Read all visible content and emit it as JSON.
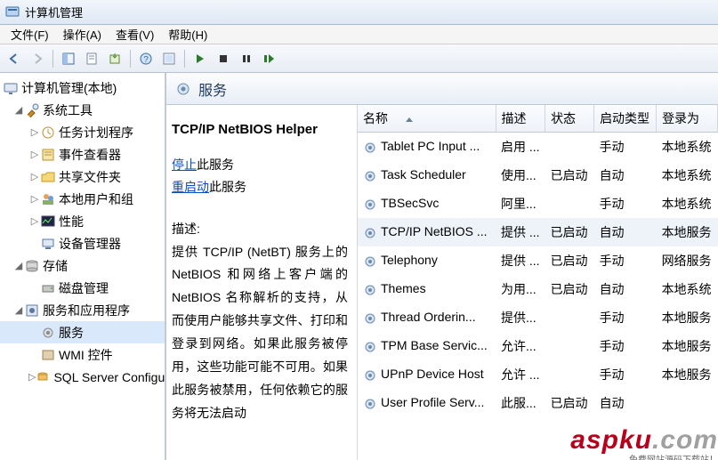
{
  "window": {
    "title": "计算机管理"
  },
  "menu": {
    "file": "文件(F)",
    "action": "操作(A)",
    "view": "查看(V)",
    "help": "帮助(H)"
  },
  "tree": {
    "root": "计算机管理(本地)",
    "sys_tools": "系统工具",
    "task_sched": "任务计划程序",
    "event_viewer": "事件查看器",
    "shared_folders": "共享文件夹",
    "local_users": "本地用户和组",
    "performance": "性能",
    "device_mgr": "设备管理器",
    "storage": "存储",
    "disk_mgmt": "磁盘管理",
    "services_apps": "服务和应用程序",
    "services": "服务",
    "wmi": "WMI 控件",
    "sql": "SQL Server Configura"
  },
  "header": {
    "title": "服务"
  },
  "detail": {
    "service_name": "TCP/IP NetBIOS Helper",
    "stop_link": "停止",
    "stop_suffix": "此服务",
    "restart_link": "重启动",
    "restart_suffix": "此服务",
    "desc_label": "描述:",
    "desc_text": "提供 TCP/IP (NetBT) 服务上的 NetBIOS 和网络上客户端的 NetBIOS 名称解析的支持，从而使用户能够共享文件、打印和登录到网络。如果此服务被停用，这些功能可能不可用。如果此服务被禁用，任何依赖它的服务将无法启动"
  },
  "columns": {
    "name": "名称",
    "desc": "描述",
    "status": "状态",
    "startup": "启动类型",
    "logon": "登录为"
  },
  "services": [
    {
      "name": "Tablet PC Input ...",
      "desc": "启用 ...",
      "status": "",
      "startup": "手动",
      "logon": "本地系统"
    },
    {
      "name": "Task Scheduler",
      "desc": "使用...",
      "status": "已启动",
      "startup": "自动",
      "logon": "本地系统"
    },
    {
      "name": "TBSecSvc",
      "desc": "阿里...",
      "status": "",
      "startup": "手动",
      "logon": "本地系统"
    },
    {
      "name": "TCP/IP NetBIOS ...",
      "desc": "提供 ...",
      "status": "已启动",
      "startup": "自动",
      "logon": "本地服务",
      "selected": true
    },
    {
      "name": "Telephony",
      "desc": "提供 ...",
      "status": "已启动",
      "startup": "手动",
      "logon": "网络服务"
    },
    {
      "name": "Themes",
      "desc": "为用...",
      "status": "已启动",
      "startup": "自动",
      "logon": "本地系统"
    },
    {
      "name": "Thread Orderin...",
      "desc": "提供...",
      "status": "",
      "startup": "手动",
      "logon": "本地服务"
    },
    {
      "name": "TPM Base Servic...",
      "desc": "允许...",
      "status": "",
      "startup": "手动",
      "logon": "本地服务"
    },
    {
      "name": "UPnP Device Host",
      "desc": "允许 ...",
      "status": "",
      "startup": "手动",
      "logon": "本地服务"
    },
    {
      "name": "User Profile Serv...",
      "desc": "此服...",
      "status": "已启动",
      "startup": "自动",
      "logon": ""
    }
  ],
  "watermark": {
    "brand_a": "asp",
    "brand_b": "ku",
    "brand_c": ".com",
    "sub": "免费网站源码下载站！"
  }
}
